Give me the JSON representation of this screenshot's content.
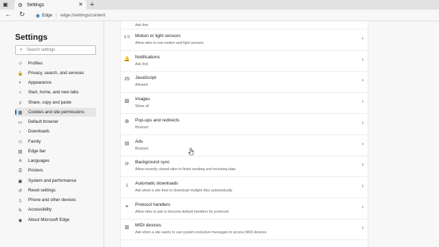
{
  "browser": {
    "tab_title": "Settings",
    "address_brand": "Edge",
    "address_url": "edge://settings/content"
  },
  "sidebar": {
    "title": "Settings",
    "search_placeholder": "Search settings",
    "items": [
      {
        "label": "Profiles",
        "icon": "profile-icon",
        "glyph": "☺"
      },
      {
        "label": "Privacy, search, and services",
        "icon": "lock-icon",
        "glyph": "🔒"
      },
      {
        "label": "Appearance",
        "icon": "appearance-icon",
        "glyph": "◐"
      },
      {
        "label": "Start, home, and new tabs",
        "icon": "home-icon",
        "glyph": "⌂"
      },
      {
        "label": "Share, copy and paste",
        "icon": "share-icon",
        "glyph": "⇪"
      },
      {
        "label": "Cookies and site permissions",
        "icon": "cookies-icon",
        "glyph": "▦"
      },
      {
        "label": "Default browser",
        "icon": "browser-icon",
        "glyph": "▭"
      },
      {
        "label": "Downloads",
        "icon": "download-icon",
        "glyph": "↓"
      },
      {
        "label": "Family",
        "icon": "family-icon",
        "glyph": "⚇"
      },
      {
        "label": "Edge bar",
        "icon": "edge-bar-icon",
        "glyph": "▤"
      },
      {
        "label": "Languages",
        "icon": "languages-icon",
        "glyph": "A"
      },
      {
        "label": "Printers",
        "icon": "printer-icon",
        "glyph": "⎙"
      },
      {
        "label": "System and performance",
        "icon": "system-icon",
        "glyph": "▣"
      },
      {
        "label": "Reset settings",
        "icon": "reset-icon",
        "glyph": "↺"
      },
      {
        "label": "Phone and other devices",
        "icon": "phone-icon",
        "glyph": "▯"
      },
      {
        "label": "Accessibility",
        "icon": "accessibility-icon",
        "glyph": "♿"
      },
      {
        "label": "About Microsoft Edge",
        "icon": "edge-logo-icon",
        "glyph": "◉"
      }
    ]
  },
  "permissions": {
    "partial_subtitle": "Ask first",
    "rows": [
      {
        "title": "Motion or light sensors",
        "subtitle": "Allow sites to use motion and light sensors",
        "icon": "sensor-icon",
        "glyph": "((·))"
      },
      {
        "title": "Notifications",
        "subtitle": "Ask first",
        "icon": "bell-icon",
        "glyph": "🔔"
      },
      {
        "title": "JavaScript",
        "subtitle": "Allowed",
        "icon": "javascript-icon",
        "glyph": "JS"
      },
      {
        "title": "Images",
        "subtitle": "Show all",
        "icon": "image-icon",
        "glyph": "▨"
      },
      {
        "title": "Pop-ups and redirects",
        "subtitle": "Blocked",
        "icon": "popup-icon",
        "glyph": "⧉"
      },
      {
        "title": "Ads",
        "subtitle": "Blocked",
        "icon": "ads-icon",
        "glyph": "▤"
      },
      {
        "title": "Background sync",
        "subtitle": "Allow recently closed sites to finish sending and receiving data",
        "icon": "sync-icon",
        "glyph": "⟳"
      },
      {
        "title": "Automatic downloads",
        "subtitle": "Ask when a site tries to download multiple files automatically",
        "icon": "download-icon",
        "glyph": "⤓"
      },
      {
        "title": "Protocol handlers",
        "subtitle": "Allow sites to ask to become default handlers for protocols",
        "icon": "link-icon",
        "glyph": "⚭"
      },
      {
        "title": "MIDI devices",
        "subtitle": "Ask when a site wants to use system exclusive messages to access MIDI devices",
        "icon": "midi-icon",
        "glyph": "▥"
      }
    ]
  }
}
